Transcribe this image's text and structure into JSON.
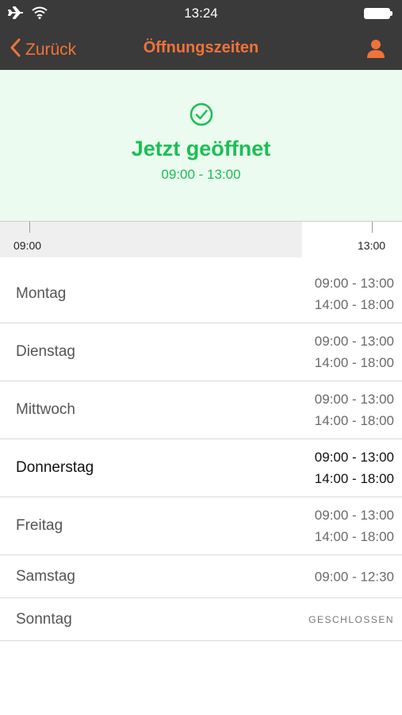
{
  "status_bar": {
    "time": "13:24",
    "icons": [
      "airplane-icon",
      "wifi-icon",
      "battery-icon"
    ]
  },
  "nav": {
    "back_label": "Zurück",
    "title": "Öffnungszeiten",
    "profile_icon": "person-icon",
    "accent_color": "#f0733a"
  },
  "status": {
    "icon": "checkmark-circle-icon",
    "headline": "Jetzt geöffnet",
    "hours": "09:00 - 13:00",
    "color": "#1bbf55"
  },
  "timeline": {
    "start_label": "09:00",
    "end_label": "13:00",
    "elapsed_fraction": 0.85
  },
  "schedule": [
    {
      "day": "Montag",
      "times": [
        "09:00 - 13:00",
        "14:00 - 18:00"
      ]
    },
    {
      "day": "Dienstag",
      "times": [
        "09:00 - 13:00",
        "14:00 - 18:00"
      ]
    },
    {
      "day": "Mittwoch",
      "times": [
        "09:00 - 13:00",
        "14:00 - 18:00"
      ]
    },
    {
      "day": "Donnerstag",
      "times": [
        "09:00 - 13:00",
        "14:00 - 18:00"
      ],
      "today": true
    },
    {
      "day": "Freitag",
      "times": [
        "09:00 - 13:00",
        "14:00 - 18:00"
      ]
    },
    {
      "day": "Samstag",
      "times": [
        "09:00 - 12:30"
      ]
    },
    {
      "day": "Sonntag",
      "closed_label": "GESCHLOSSEN"
    }
  ]
}
